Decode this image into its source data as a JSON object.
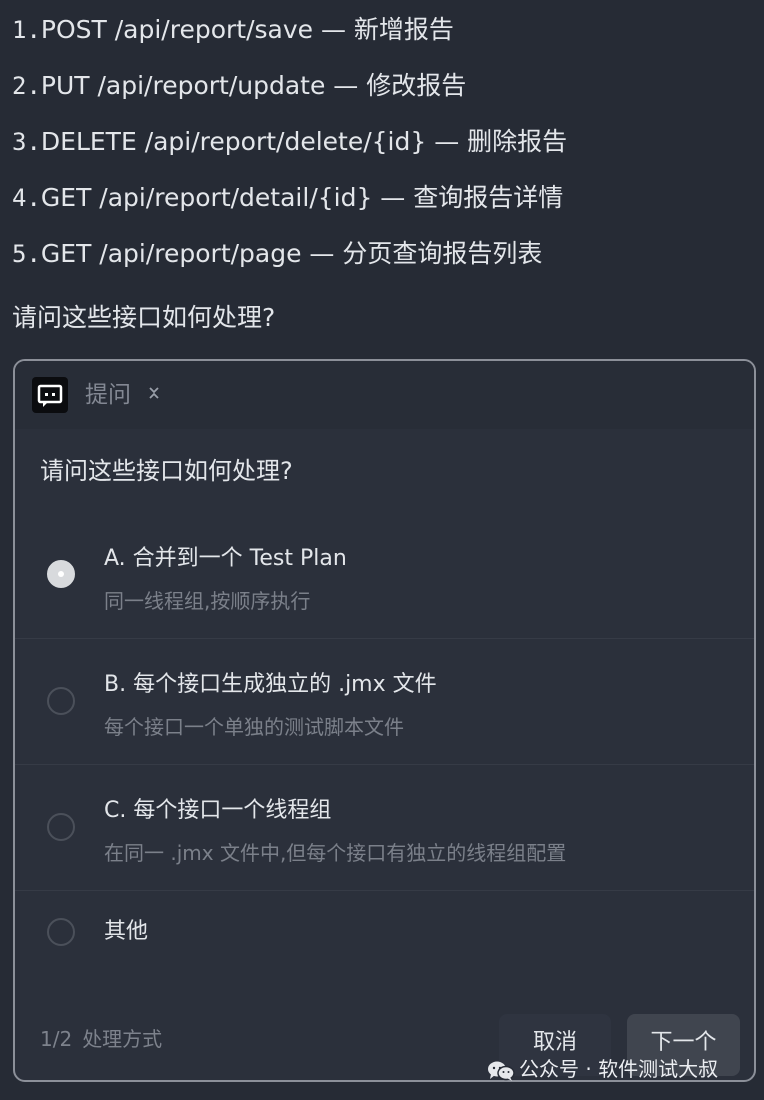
{
  "endpoints": [
    {
      "num": "1.",
      "text": "POST /api/report/save — 新增报告"
    },
    {
      "num": "2.",
      "text": "PUT /api/report/update — 修改报告"
    },
    {
      "num": "3.",
      "text": "DELETE /api/report/delete/{id} — 删除报告"
    },
    {
      "num": "4.",
      "text": "GET /api/report/detail/{id} — 查询报告详情"
    },
    {
      "num": "5.",
      "text": "GET /api/report/page — 分页查询报告列表"
    }
  ],
  "question": "请问这些接口如何处理?",
  "dialog": {
    "header": {
      "icon": "chat-bubble-icon",
      "title": "提问",
      "toggle_icon": "collapse-chevron-icon"
    },
    "question": "请问这些接口如何处理?",
    "options": [
      {
        "title": "A. 合并到一个 Test Plan",
        "description": "同一线程组,按顺序执行",
        "selected": true
      },
      {
        "title": "B. 每个接口生成独立的 .jmx 文件",
        "description": "每个接口一个单独的测试脚本文件",
        "selected": false
      },
      {
        "title": "C. 每个接口一个线程组",
        "description": "在同一 .jmx 文件中,但每个接口有独立的线程组配置",
        "selected": false
      },
      {
        "title": "其他",
        "description": "",
        "selected": false
      }
    ],
    "footer": {
      "pager": "1/2",
      "pager_label": "处理方式",
      "cancel_label": "取消",
      "next_label": "下一个"
    }
  },
  "watermark": {
    "icon": "wechat-icon",
    "text": "公众号 · 软件测试大叔"
  },
  "colors": {
    "background": "#262b35",
    "dialog_background": "#2b303b",
    "dialog_border": "#8c9099",
    "muted_text": "#7b808a",
    "primary_text": "#e3e6ea"
  }
}
